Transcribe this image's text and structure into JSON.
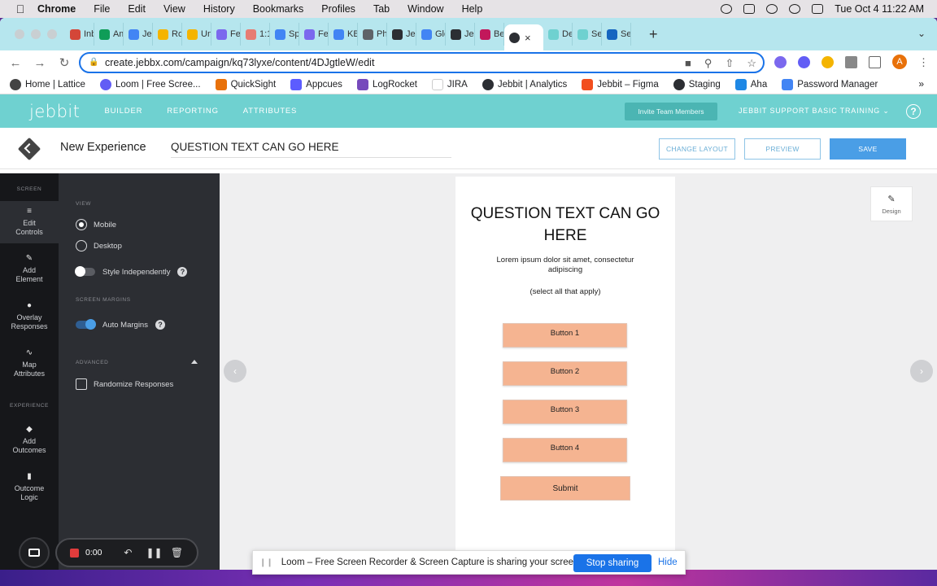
{
  "menubar": {
    "app": "Chrome",
    "items": [
      "File",
      "Edit",
      "View",
      "History",
      "Bookmarks",
      "Profiles",
      "Tab",
      "Window",
      "Help"
    ],
    "clock": "Tue Oct 4  11:22 AM"
  },
  "tabs": [
    {
      "label": "Inb",
      "color": "#d44638"
    },
    {
      "label": "Am",
      "color": "#0f9d58"
    },
    {
      "label": "Jeb",
      "color": "#4285f4"
    },
    {
      "label": "Ro",
      "color": "#f4b400"
    },
    {
      "label": "Un",
      "color": "#f4b400"
    },
    {
      "label": "Fe",
      "color": "#7b68ee"
    },
    {
      "label": "1:1",
      "color": "#e67c73"
    },
    {
      "label": "Sp",
      "color": "#4285f4"
    },
    {
      "label": "Fe",
      "color": "#7b68ee"
    },
    {
      "label": "KB",
      "color": "#4285f4"
    },
    {
      "label": "Ph",
      "color": "#5f6368"
    },
    {
      "label": "Jel",
      "color": "#2c2e33"
    },
    {
      "label": "Glo",
      "color": "#4285f4"
    },
    {
      "label": "Jel",
      "color": "#2c2e33"
    },
    {
      "label": "Be",
      "color": "#c2185b"
    }
  ],
  "active_tab": {
    "close": "×"
  },
  "tabs_after": [
    {
      "label": "De",
      "color": "#6fd1d0"
    },
    {
      "label": "Se",
      "color": "#6fd1d0"
    },
    {
      "label": "Se",
      "color": "#1565c0"
    }
  ],
  "browser": {
    "url": "create.jebbx.com/campaign/kq73lyxe/content/4DJgtleW/edit",
    "profile_initial": "A"
  },
  "bookmarks": [
    {
      "label": "Home | Lattice",
      "color": "#444"
    },
    {
      "label": "Loom | Free Scree...",
      "color": "#625df5"
    },
    {
      "label": "QuickSight",
      "color": "#e8710a"
    },
    {
      "label": "Appcues",
      "color": "#5c5cff"
    },
    {
      "label": "LogRocket",
      "color": "#764abc"
    },
    {
      "label": "JIRA",
      "color": "#ffffff"
    },
    {
      "label": "Jebbit | Analytics",
      "color": "#2c2e33"
    },
    {
      "label": "Jebbit – Figma",
      "color": "#f24e1e"
    },
    {
      "label": "Staging",
      "color": "#2c2e33"
    },
    {
      "label": "Aha",
      "color": "#1e88e5"
    },
    {
      "label": "Password Manager",
      "color": "#4285f4"
    }
  ],
  "appnav": {
    "logo": "jebbit",
    "items": [
      "BUILDER",
      "REPORTING",
      "ATTRIBUTES"
    ],
    "invite": "Invite Team Members",
    "org": "JEBBIT SUPPORT BASIC TRAINING",
    "help": "?"
  },
  "header": {
    "experience_title": "New Experience",
    "question_title": "QUESTION TEXT CAN GO HERE",
    "change_layout": "CHANGE LAYOUT",
    "preview": "PREVIEW",
    "save": "SAVE"
  },
  "rail": {
    "screen_label": "SCREEN",
    "experience_label": "EXPERIENCE",
    "items": [
      {
        "line1": "Edit",
        "line2": "Controls"
      },
      {
        "line1": "Add",
        "line2": "Element"
      },
      {
        "line1": "Overlay",
        "line2": "Responses"
      },
      {
        "line1": "Map",
        "line2": "Attributes"
      },
      {
        "line1": "Add",
        "line2": "Outcomes"
      },
      {
        "line1": "Outcome",
        "line2": "Logic"
      }
    ]
  },
  "panel": {
    "view_label": "VIEW",
    "mobile": "Mobile",
    "desktop": "Desktop",
    "style_independently": "Style Independently",
    "margins_label": "SCREEN MARGINS",
    "auto_margins": "Auto Margins",
    "advanced_label": "ADVANCED",
    "randomize": "Randomize Responses",
    "help": "?"
  },
  "preview": {
    "question": "QUESTION TEXT CAN GO HERE",
    "body": "Lorem ipsum dolor sit amet, consectetur adipiscing",
    "hint": "(select all that apply)",
    "buttons": [
      "Button 1",
      "Button 2",
      "Button 3",
      "Button 4"
    ],
    "submit": "Submit",
    "design": "Design"
  },
  "loom": {
    "timer": "0:00",
    "share_message": "Loom – Free Screen Recorder & Screen Capture is sharing your screen.",
    "stop": "Stop sharing",
    "hide": "Hide"
  },
  "colors": {
    "brand": "#6fd1d0",
    "accent": "#4a9ee6",
    "answer": "#f5b491"
  }
}
